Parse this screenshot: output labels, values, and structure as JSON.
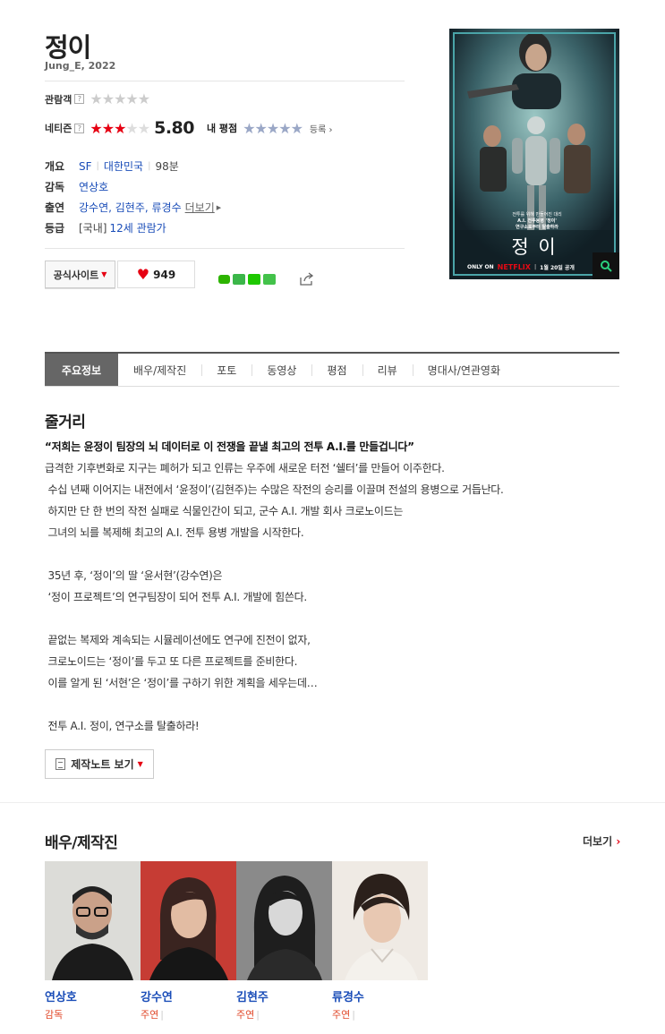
{
  "movie": {
    "title": "정이",
    "subtitle": "Jung_E, 2022"
  },
  "ratings": {
    "audience_label": "관람객",
    "audience_stars": 0,
    "netizen_label": "네티즌",
    "netizen_stars": 3,
    "netizen_score": "5.80",
    "my_rating_label": "내 평점",
    "register_label": "등록",
    "help_glyph": "?"
  },
  "info": {
    "overview_label": "개요",
    "genre": "SF",
    "country": "대한민국",
    "runtime": "98분",
    "director_label": "감독",
    "director": "연상호",
    "cast_label": "출연",
    "cast_names": "강수연, 김현주, 류경수",
    "cast_more": "더보기",
    "grade_label": "등급",
    "grade_prefix": "[국내]",
    "grade": "12세 관람가"
  },
  "actions": {
    "official_site": "공식사이트",
    "likes": "949"
  },
  "poster": {
    "tagline_1": "전투를 위해 만들어진 대리",
    "tagline_2": "A.I. 전투용병 '정이'",
    "tagline_3": "연구소로부터 탈출하라",
    "title": "정 이",
    "only_on": "ONLY ON",
    "brand": "NETFLIX",
    "release": "1월 20일 공개",
    "colors": {
      "netflix": "#e50914",
      "frame": "#4aa4a8"
    }
  },
  "tabs": [
    "주요정보",
    "배우/제작진",
    "포토",
    "동영상",
    "평점",
    "리뷰",
    "명대사/연관영화"
  ],
  "synopsis": {
    "heading": "줄거리",
    "lead": "“저희는 윤정이 팀장의 뇌 데이터로 이 전쟁을 끝낼 최고의 전투 A.I.를 만들겁니다”",
    "lines": [
      "급격한 기후변화로 지구는 폐허가 되고 인류는 우주에 새로운 터전 ‘쉘터’를 만들어 이주한다.",
      " 수십 년째 이어지는 내전에서 ‘윤정이’(김현주)는 수많은 작전의 승리를 이끌며 전설의 용병으로 거듭난다.",
      " 하지만 단 한 번의 작전 실패로 식물인간이 되고, 군수 A.I. 개발 회사 크로노이드는",
      " 그녀의 뇌를 복제해 최고의 A.I. 전투 용병 개발을 시작한다.",
      "",
      " 35년 후, ‘정이’의 딸 ‘윤서현’(강수연)은",
      " ‘정이 프로젝트’의 연구팀장이 되어 전투 A.I. 개발에 힘쓴다.",
      "",
      " 끝없는 복제와 계속되는 시뮬레이션에도 연구에 진전이 없자,",
      " 크로노이드는 ‘정이’를 두고 또 다른 프로젝트를 준비한다.",
      " 이를 알게 된 ‘서현’은 ‘정이’를 구하기 위한 계획을 세우는데…",
      "",
      " 전투 A.I. 정이, 연구소를 탈출하라!"
    ],
    "note_button": "제작노트 보기"
  },
  "cast_section": {
    "heading": "배우/제작진",
    "more": "더보기",
    "people": [
      {
        "name": "연상호",
        "role": "감독",
        "bar": ""
      },
      {
        "name": "강수연",
        "role": "주연",
        "bar": "|"
      },
      {
        "name": "김현주",
        "role": "주연",
        "bar": "|"
      },
      {
        "name": "류경수",
        "role": "주연",
        "bar": "|"
      }
    ]
  }
}
